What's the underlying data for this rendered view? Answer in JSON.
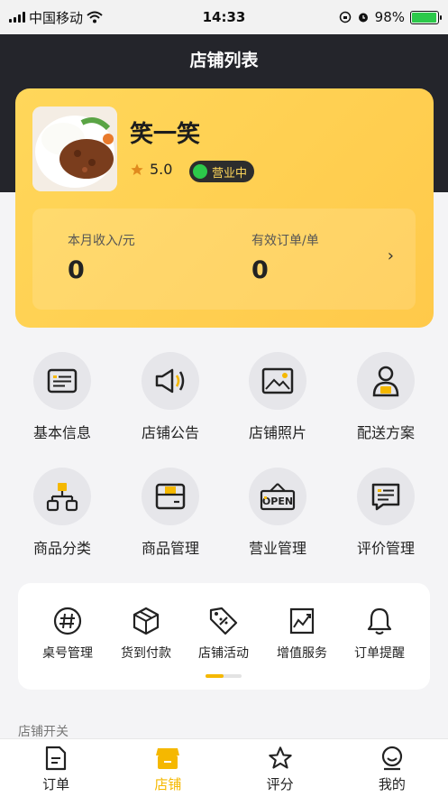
{
  "status_bar": {
    "carrier": "中国移动",
    "time": "14:33",
    "battery": "98%",
    "battery_level": 0.98
  },
  "header": {
    "title": "店铺列表"
  },
  "store": {
    "name": "笑一笑",
    "rating": "5.0",
    "status": "营业中",
    "stats": [
      {
        "label": "本月收入/元",
        "value": "0"
      },
      {
        "label": "有效订单/单",
        "value": "0"
      }
    ],
    "arrow": "›"
  },
  "menu": [
    {
      "label": "基本信息",
      "icon": "info-card-icon"
    },
    {
      "label": "店铺公告",
      "icon": "megaphone-icon"
    },
    {
      "label": "店铺照片",
      "icon": "photo-icon"
    },
    {
      "label": "配送方案",
      "icon": "courier-icon"
    },
    {
      "label": "商品分类",
      "icon": "hierarchy-icon"
    },
    {
      "label": "商品管理",
      "icon": "product-box-icon"
    },
    {
      "label": "营业管理",
      "icon": "open-sign-icon"
    },
    {
      "label": "评价管理",
      "icon": "review-icon"
    }
  ],
  "tools": [
    {
      "label": "桌号管理",
      "icon": "hash-icon"
    },
    {
      "label": "货到付款",
      "icon": "package-icon"
    },
    {
      "label": "店铺活动",
      "icon": "discount-tag-icon"
    },
    {
      "label": "增值服务",
      "icon": "chart-icon"
    },
    {
      "label": "订单提醒",
      "icon": "bell-icon"
    }
  ],
  "section_hint": "店铺开关",
  "tabs": [
    {
      "label": "订单",
      "icon": "order-icon",
      "active": false
    },
    {
      "label": "店铺",
      "icon": "shop-icon",
      "active": true
    },
    {
      "label": "评分",
      "icon": "star-icon",
      "active": false
    },
    {
      "label": "我的",
      "icon": "profile-icon",
      "active": false
    }
  ],
  "colors": {
    "accent": "#F5B800",
    "header_bg": "#24252B",
    "card_bg": "#FFD75A",
    "status_green": "#2CC94A"
  }
}
